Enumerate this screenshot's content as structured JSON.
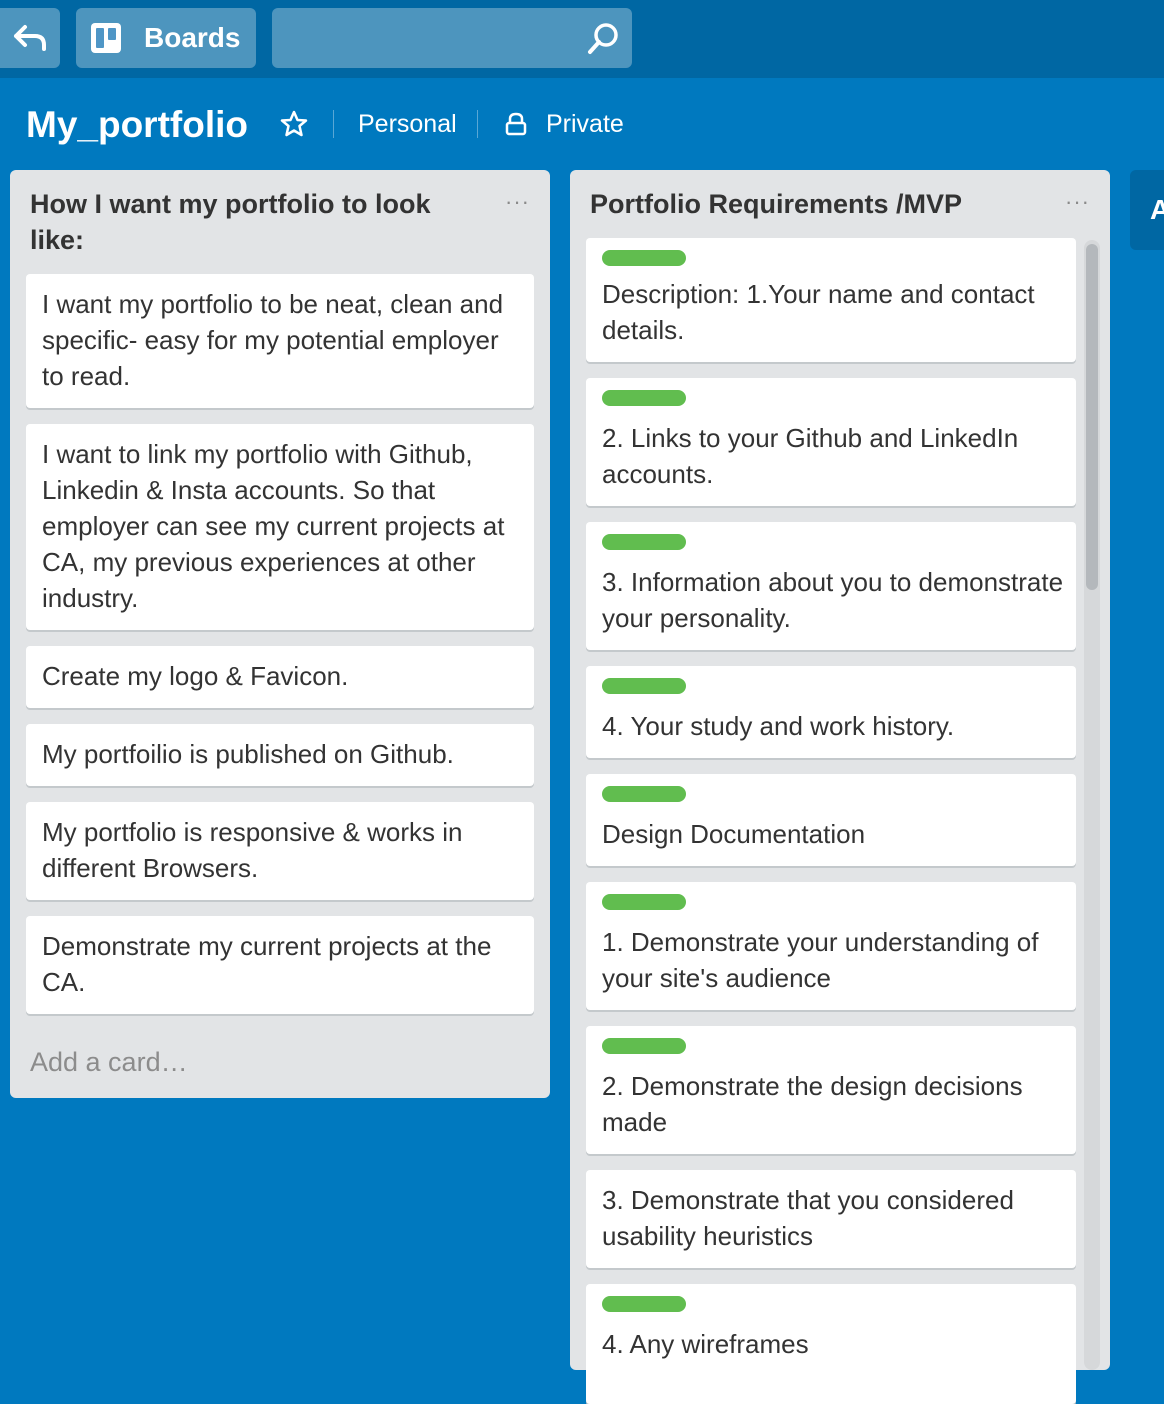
{
  "header": {
    "boards_label": "Boards",
    "search_placeholder": ""
  },
  "board": {
    "title": "My_portfolio",
    "team": "Personal",
    "visibility": "Private"
  },
  "lists": [
    {
      "title": "How I want my portfolio to look like:",
      "menu": "···",
      "cards": [
        {
          "text": "I want my portfolio to be neat, clean and specific- easy for my potential employer to read."
        },
        {
          "text": "I want to link my portfolio with Github, Linkedin & Insta accounts. So that employer can see my current projects at CA, my previous experiences at other industry."
        },
        {
          "text": "Create my logo & Favicon."
        },
        {
          "text": "My portfoilio is published on Github."
        },
        {
          "text": "My portfolio is responsive & works in different Browsers."
        },
        {
          "text": "Demonstrate my current projects at the CA."
        }
      ],
      "add_card": "Add a card…"
    },
    {
      "title": "Portfolio Requirements /MVP",
      "menu": "···",
      "cards": [
        {
          "text": "Description: 1.Your name and contact details.",
          "label": "green"
        },
        {
          "text": "2. Links to your Github and LinkedIn accounts.",
          "label": "green"
        },
        {
          "text": "3. Information about you to demonstrate your personality.",
          "label": "green"
        },
        {
          "text": "4. Your study and work history.",
          "label": "green"
        },
        {
          "text": "Design Documentation",
          "label": "green"
        },
        {
          "text": "1. Demonstrate your understanding of your site's audience",
          "label": "green"
        },
        {
          "text": "2. Demonstrate the design decisions made",
          "label": "green"
        },
        {
          "text": "3. Demonstrate that you considered usability heuristics"
        },
        {
          "text": "4. Any wireframes",
          "label": "green"
        }
      ]
    },
    {
      "title": "A"
    }
  ],
  "colors": {
    "board_bg": "#0079bf",
    "header_bg": "#0067a3",
    "label_green": "#61bd4f"
  }
}
